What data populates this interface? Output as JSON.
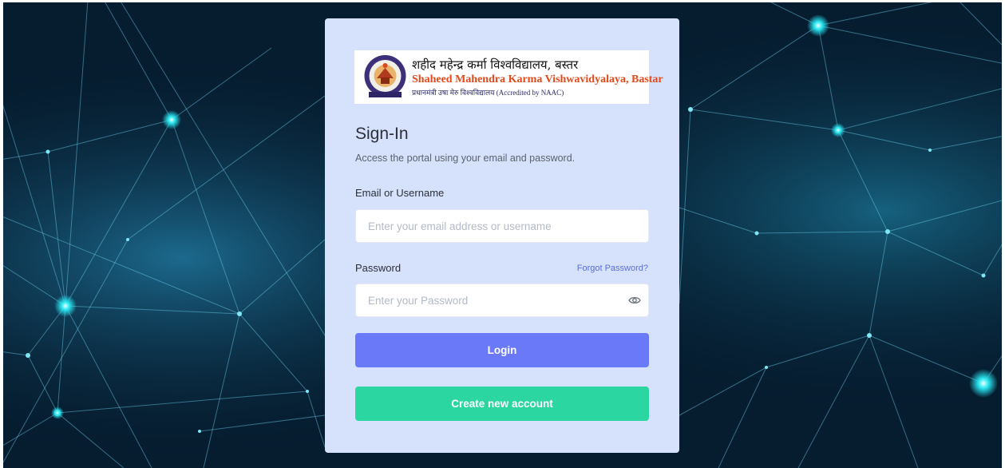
{
  "colors": {
    "card_background": "#d6e2fb",
    "login_button": "#6979f8",
    "create_button": "#2bd6a0",
    "link": "#5c6ed6",
    "page_background": "#051a2c",
    "network_nodes": "#19e6f0"
  },
  "logo": {
    "hindi_name": "शहीद महेन्द्र कर्मा विश्वविद्यालय, बस्तर",
    "english_name": "Shaheed Mahendra Karma Vishwavidyalaya, Bastar",
    "subtitle": "प्रधानमंत्री उषा मेरु विश्वविद्यालय (Accredited by NAAC)"
  },
  "signin": {
    "title": "Sign-In",
    "subtitle": "Access the portal using your email and password."
  },
  "email": {
    "label": "Email or Username",
    "placeholder": "Enter your email address or username",
    "value": ""
  },
  "password": {
    "label": "Password",
    "placeholder": "Enter your Password",
    "value": "",
    "forgot_label": "Forgot Password?",
    "toggle_icon": "eye-icon"
  },
  "buttons": {
    "login_label": "Login",
    "create_label": "Create new account"
  }
}
